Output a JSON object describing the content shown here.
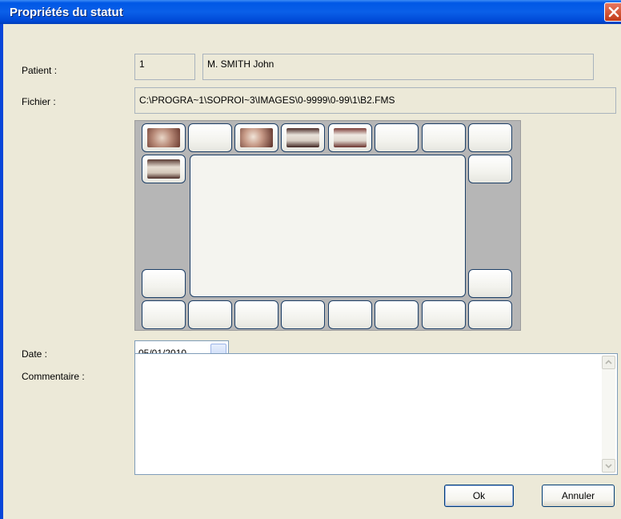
{
  "window": {
    "title": "Propriétés du statut"
  },
  "form": {
    "patient_label": "Patient :",
    "patient_id": "1",
    "patient_name": "M. SMITH John",
    "file_label": "Fichier :",
    "file_path": "C:\\PROGRA~1\\SOPROI~3\\IMAGES\\0-9999\\0-99\\1\\B2.FMS",
    "date_label": "Date :",
    "date_value": "05/01/2010",
    "comment_label": "Commentaire :",
    "comment_value": ""
  },
  "buttons": {
    "ok": "Ok",
    "cancel": "Annuler"
  },
  "icons": {
    "close": "close-icon",
    "dropdown": "chevron-down-icon",
    "scroll_up": "scroll-up-icon",
    "scroll_down": "scroll-down-icon"
  },
  "colors": {
    "titlebar": "#0a5fe8",
    "close": "#c13b18",
    "panel": "#b6b6b6",
    "slot_border": "#1c3e66"
  }
}
